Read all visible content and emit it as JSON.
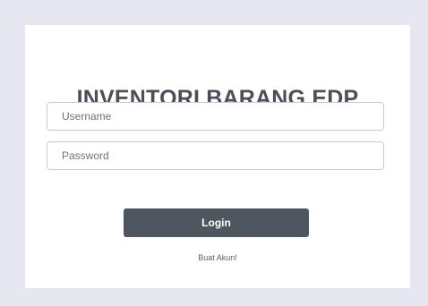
{
  "login_form": {
    "title": "INVENTORI BARANG EDP",
    "username": {
      "placeholder": "Username",
      "value": ""
    },
    "password": {
      "placeholder": "Password",
      "value": ""
    },
    "login_label": "Login",
    "signup_label": "Buat Akun!"
  },
  "colors": {
    "background": "#e6e7f0",
    "card": "#ffffff",
    "title_text": "#4b5058",
    "button": "#4e5660",
    "button_text": "#ffffff"
  }
}
